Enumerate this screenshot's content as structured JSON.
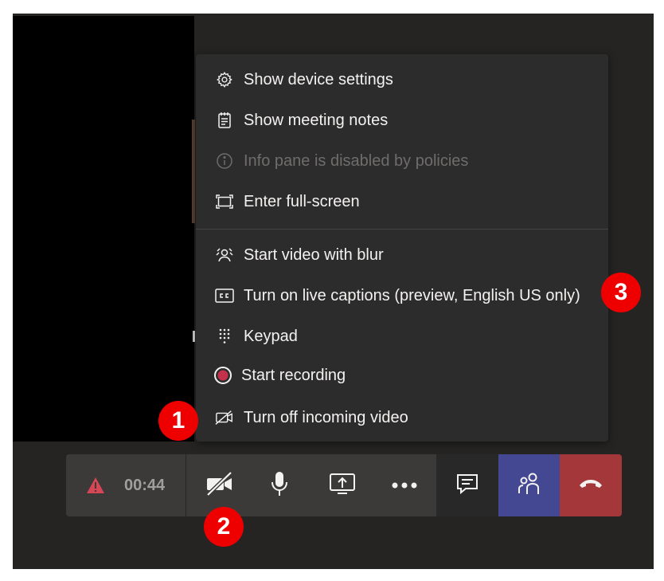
{
  "menu": {
    "items": [
      {
        "label": "Show device settings",
        "icon": "gear-icon",
        "disabled": false
      },
      {
        "label": "Show meeting notes",
        "icon": "notes-icon",
        "disabled": false
      },
      {
        "label": "Info pane is disabled by policies",
        "icon": "info-icon",
        "disabled": true
      },
      {
        "label": "Enter full-screen",
        "icon": "fullscreen-icon",
        "disabled": false
      },
      {
        "label": "Start video with blur",
        "icon": "blur-video-icon",
        "disabled": false
      },
      {
        "label": "Turn on live captions (preview, English US only)",
        "icon": "captions-icon",
        "disabled": false
      },
      {
        "label": "Keypad",
        "icon": "keypad-icon",
        "disabled": false
      },
      {
        "label": "Start recording",
        "icon": "record-icon",
        "disabled": false
      },
      {
        "label": "Turn off incoming video",
        "icon": "video-off-icon",
        "disabled": false
      }
    ]
  },
  "toolbar": {
    "timer": "00:44",
    "warning_icon": "warning-icon",
    "buttons": [
      "camera-off-icon",
      "microphone-icon",
      "share-screen-icon",
      "more-options-icon",
      "chat-icon",
      "participants-icon",
      "hang-up-icon"
    ]
  },
  "badges": {
    "one": "1",
    "two": "2",
    "three": "3"
  },
  "colors": {
    "badge": "#ee0000",
    "hangup": "#a4373a",
    "participants": "#444791",
    "warning": "#d74654",
    "record": "#c4314b"
  }
}
